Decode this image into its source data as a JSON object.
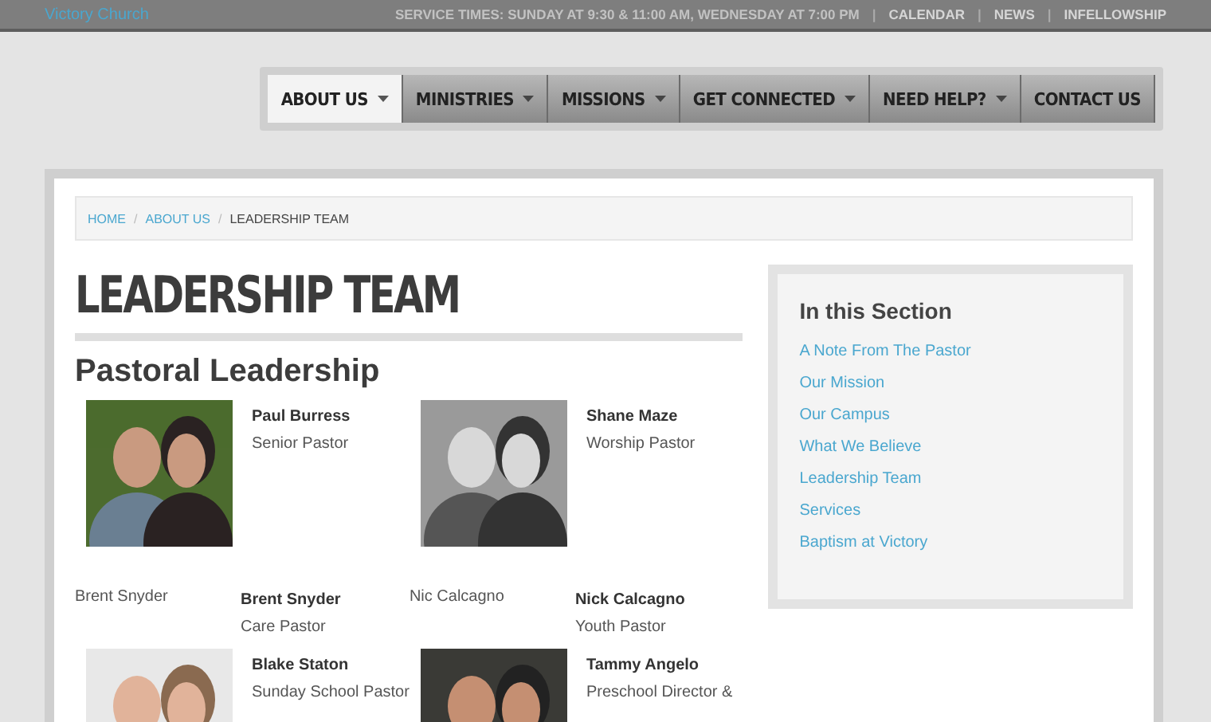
{
  "site_name": "Victory Church",
  "top_links": [
    {
      "label": "SERVICE TIMES: SUNDAY AT 9:30 & 11:00 AM, WEDNESDAY AT 7:00 PM",
      "kind": "text"
    },
    {
      "label": "|",
      "kind": "separator"
    },
    {
      "label": "CALENDAR",
      "kind": "link"
    },
    {
      "label": "|",
      "kind": "separator"
    },
    {
      "label": "NEWS",
      "kind": "link"
    },
    {
      "label": "|",
      "kind": "separator"
    },
    {
      "label": "INFELLOWSHIP",
      "kind": "link"
    }
  ],
  "nav": [
    {
      "label": "ABOUT US",
      "selected": true,
      "dropdown": true
    },
    {
      "label": "MINISTRIES",
      "selected": false,
      "dropdown": true
    },
    {
      "label": "MISSIONS",
      "selected": false,
      "dropdown": true
    },
    {
      "label": "GET CONNECTED",
      "selected": false,
      "dropdown": true
    },
    {
      "label": "NEED HELP?",
      "selected": false,
      "dropdown": true
    },
    {
      "label": "CONTACT US",
      "selected": false,
      "dropdown": false
    }
  ],
  "breadcrumb": [
    {
      "label": "HOME",
      "kind": "link"
    },
    {
      "label": "/",
      "kind": "separator"
    },
    {
      "label": "ABOUT US",
      "kind": "link"
    },
    {
      "label": "/",
      "kind": "separator"
    },
    {
      "label": "LEADERSHIP TEAM",
      "kind": "current"
    }
  ],
  "page_title": "LEADERSHIP TEAM",
  "section_title": "Pastoral Leadership",
  "members": [
    {
      "name": "Paul Burress",
      "role": "Senior Pastor"
    },
    {
      "name": "Shane Maze",
      "role": "Worship Pastor"
    },
    {
      "name": "Brent Snyder",
      "role": "Care Pastor",
      "kind": "alt",
      "alt": "Brent Snyder"
    },
    {
      "name": "Nick Calcagno",
      "role": "Youth Pastor",
      "kind": "alt",
      "alt": "Nic Calcagno"
    },
    {
      "name": "Blake Staton",
      "role": "Sunday School Pastor"
    },
    {
      "name": "Tammy Angelo",
      "role": "Preschool Director &"
    }
  ],
  "sidebar": {
    "title": "In this Section",
    "links": [
      "A Note From The Pastor",
      "Our Mission",
      "Our Campus",
      "What We Believe",
      "Leadership Team",
      "Services",
      "Baptism at Victory"
    ]
  }
}
